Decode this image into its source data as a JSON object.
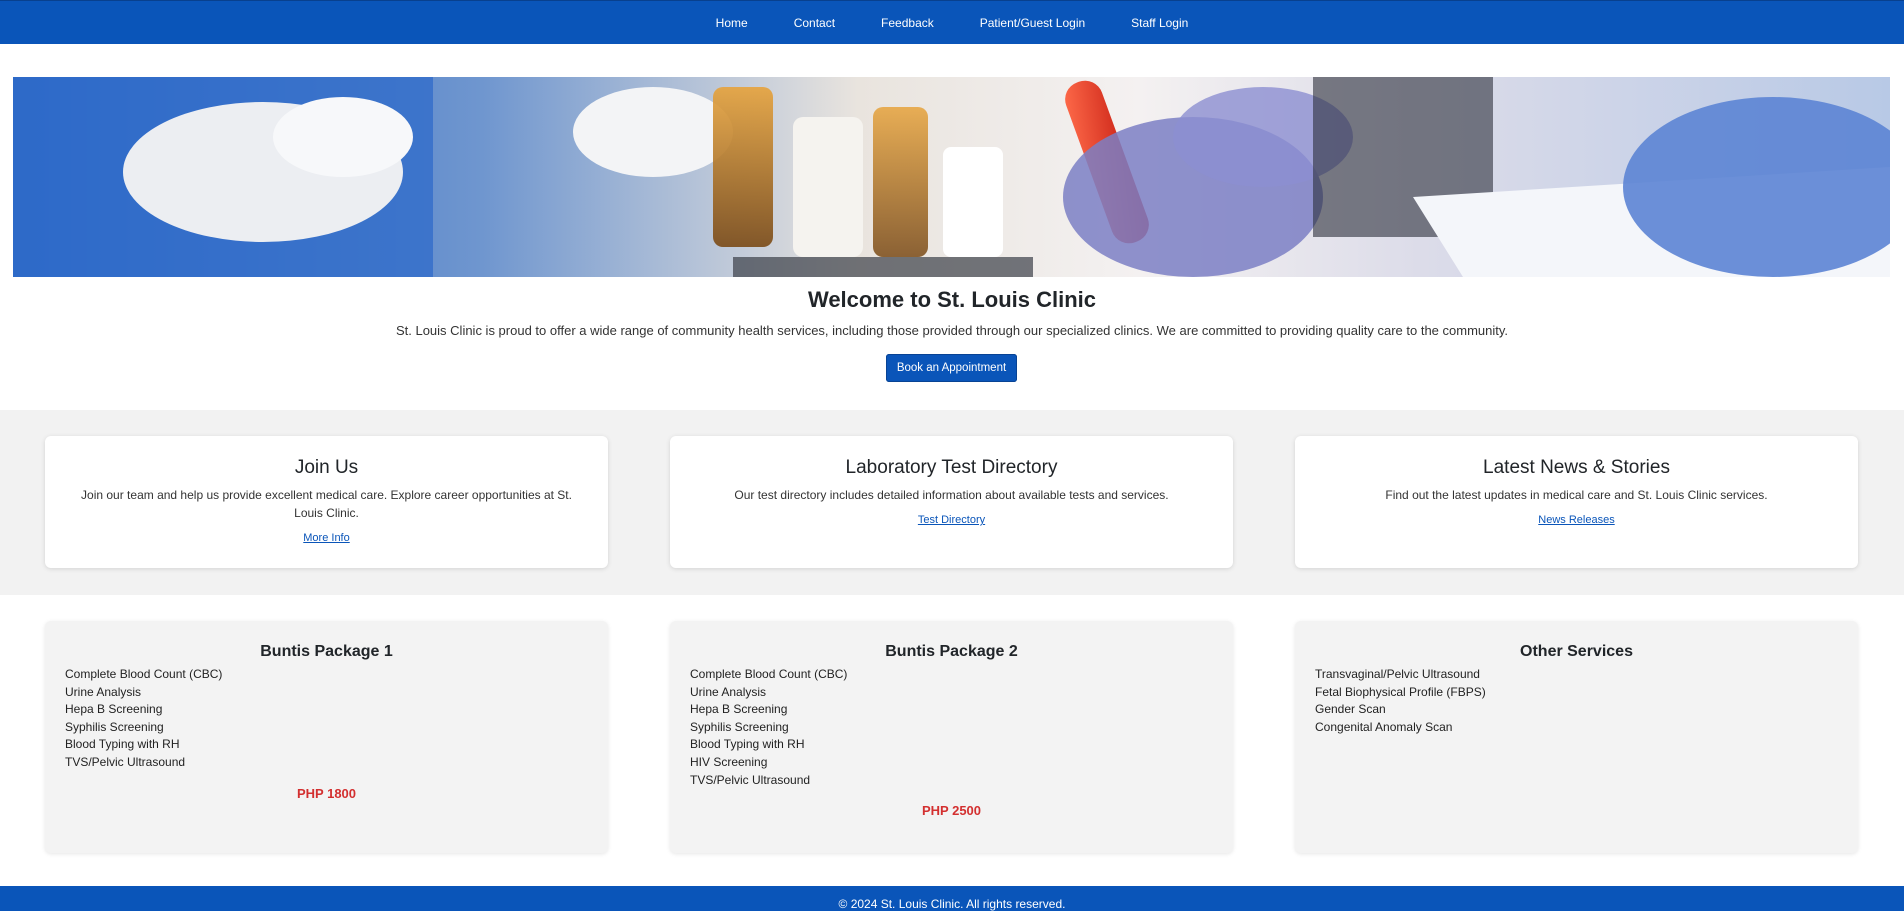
{
  "nav": {
    "items": [
      {
        "label": "Home"
      },
      {
        "label": "Contact"
      },
      {
        "label": "Feedback"
      },
      {
        "label": "Patient/Guest Login"
      },
      {
        "label": "Staff Login"
      }
    ]
  },
  "hero": {
    "image": "hero-laboratory-photo"
  },
  "welcome": {
    "title": "Welcome to St. Louis Clinic",
    "text": "St. Louis Clinic is proud to offer a wide range of community health services, including those provided through our specialized clinics. We are committed to providing quality care to the community.",
    "button_label": "Book an Appointment"
  },
  "info_cards": [
    {
      "title": "Join Us",
      "text": "Join our team and help us provide excellent medical care. Explore career opportunities at St. Louis Clinic.",
      "link": "More Info"
    },
    {
      "title": "Laboratory Test Directory",
      "text": "Our test directory includes detailed information about available tests and services.",
      "link": "Test Directory"
    },
    {
      "title": "Latest News & Stories",
      "text": "Find out the latest updates in medical care and St. Louis Clinic services.",
      "link": "News Releases"
    }
  ],
  "packages": [
    {
      "title": "Buntis Package 1",
      "items": [
        "Complete Blood Count (CBC)",
        "Urine Analysis",
        "Hepa B Screening",
        "Syphilis Screening",
        "Blood Typing with RH",
        "TVS/Pelvic Ultrasound"
      ],
      "price": "PHP 1800"
    },
    {
      "title": "Buntis Package 2",
      "items": [
        "Complete Blood Count (CBC)",
        "Urine Analysis",
        "Hepa B Screening",
        "Syphilis Screening",
        "Blood Typing with RH",
        "HIV Screening",
        "TVS/Pelvic Ultrasound"
      ],
      "price": "PHP 2500"
    },
    {
      "title": "Other Services",
      "items": [
        "Transvaginal/Pelvic Ultrasound",
        "Fetal Biophysical Profile (FBPS)",
        "Gender Scan",
        "Congenital Anomaly Scan"
      ],
      "price": ""
    }
  ],
  "footer": {
    "text": "© 2024 St. Louis Clinic. All rights reserved."
  },
  "colors": {
    "primary": "#0a55b9",
    "price": "#d32f2f",
    "band": "#f2f2f2"
  }
}
